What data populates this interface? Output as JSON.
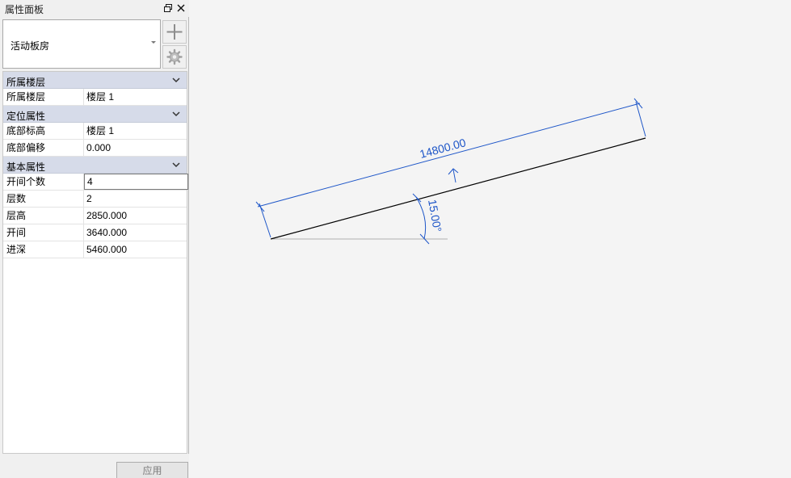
{
  "panel": {
    "title": "属性面板",
    "type_selector": {
      "value": "活动板房"
    },
    "apply_label": "应用"
  },
  "groups": [
    {
      "label": "所属楼层",
      "rows": [
        {
          "name": "所属楼层",
          "value": "楼层 1"
        }
      ]
    },
    {
      "label": "定位属性",
      "rows": [
        {
          "name": "底部标高",
          "value": "楼层 1"
        },
        {
          "name": "底部偏移",
          "value": "0.000"
        }
      ]
    },
    {
      "label": "基本属性",
      "rows": [
        {
          "name": "开间个数",
          "value": "4",
          "editing": true
        },
        {
          "name": "层数",
          "value": "2"
        },
        {
          "name": "层高",
          "value": "2850.000"
        },
        {
          "name": "开间",
          "value": "3640.000"
        },
        {
          "name": "进深",
          "value": "5460.000"
        }
      ]
    }
  ],
  "drawing": {
    "length_dimension": "14800.00",
    "angle_dimension": "15.00°",
    "dimension_color": "#1e56c8",
    "line_color": "#000000"
  },
  "icons": {
    "restore": "restore-window-icon",
    "close": "close-icon",
    "add": "plus-icon",
    "edit": "gear-icon",
    "group_toggle": "chevron-up-icon"
  }
}
